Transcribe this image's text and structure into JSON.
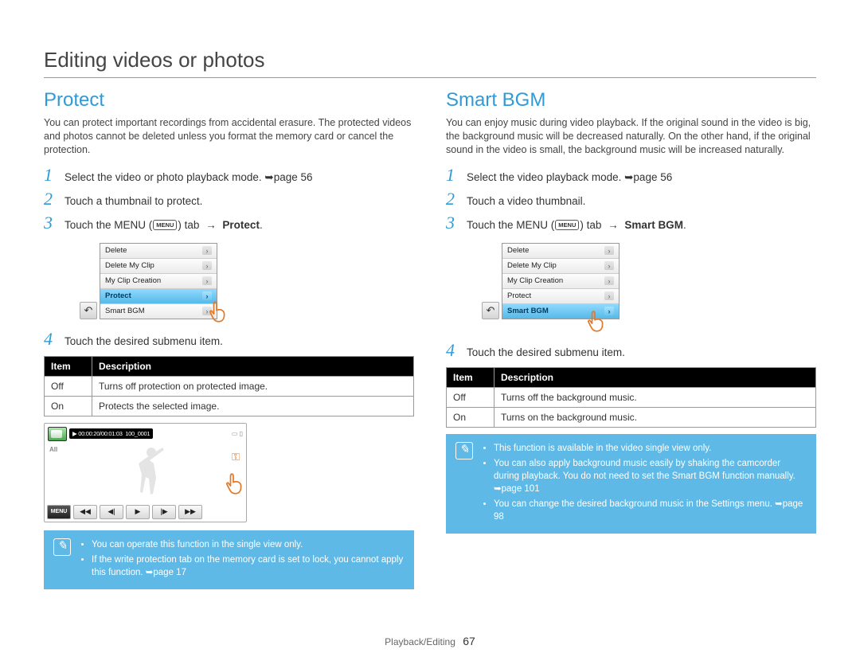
{
  "page_title": "Editing videos or photos",
  "footer": {
    "section": "Playback/Editing",
    "page": "67"
  },
  "left": {
    "heading": "Protect",
    "intro": "You can protect important recordings from accidental erasure. The protected videos and photos cannot be deleted unless you format the memory card or cancel the protection.",
    "steps": {
      "s1": "Select the video or photo playback mode. ➥page 56",
      "s2": "Touch a thumbnail to protect.",
      "s3_pre": "Touch the MENU (",
      "s3_mid": ") tab ",
      "s3_arrow": "→",
      "s3_bold": "Protect",
      "s3_post": ".",
      "s4": "Touch the desired submenu item."
    },
    "menu_icon_label": "MENU",
    "menu_items": [
      "Delete",
      "Delete My Clip",
      "My Clip Creation",
      "Protect",
      "Smart BGM"
    ],
    "menu_selected_index": 3,
    "table": {
      "h1": "Item",
      "h2": "Description",
      "r1c1": "Off",
      "r1c2": "Turns off protection on protected image.",
      "r2c1": "On",
      "r2c2": "Protects the selected image."
    },
    "preview": {
      "time": "00:00:20/00:01:03",
      "clip": "100_0001",
      "all": "All",
      "menu_label": "MENU"
    },
    "notes": [
      "You can operate this function in the single view only.",
      "If the write protection tab on the memory card is set to lock, you cannot apply this function. ➥page 17"
    ]
  },
  "right": {
    "heading": "Smart BGM",
    "intro": "You can enjoy music during video playback. If the original sound in the video is big, the background music will be decreased naturally. On the other hand, if the original sound in the video is small, the background music will be increased naturally.",
    "steps": {
      "s1": "Select the video playback mode. ➥page 56",
      "s2": "Touch a video thumbnail.",
      "s3_pre": "Touch the MENU (",
      "s3_mid": ") tab ",
      "s3_arrow": "→",
      "s3_bold": "Smart BGM",
      "s3_post": ".",
      "s4": "Touch the desired submenu item."
    },
    "menu_icon_label": "MENU",
    "menu_items": [
      "Delete",
      "Delete My Clip",
      "My Clip Creation",
      "Protect",
      "Smart BGM"
    ],
    "menu_selected_index": 4,
    "table": {
      "h1": "Item",
      "h2": "Description",
      "r1c1": "Off",
      "r1c2": "Turns off the background music.",
      "r2c1": "On",
      "r2c2": "Turns on the background music."
    },
    "notes": [
      "This function is available in the video single view only.",
      "You can also apply background music easily by shaking the camcorder during playback. You do not need to set the Smart BGM function manually. ➥page 101",
      "You can change the desired background music in the Settings menu. ➥page 98"
    ]
  }
}
